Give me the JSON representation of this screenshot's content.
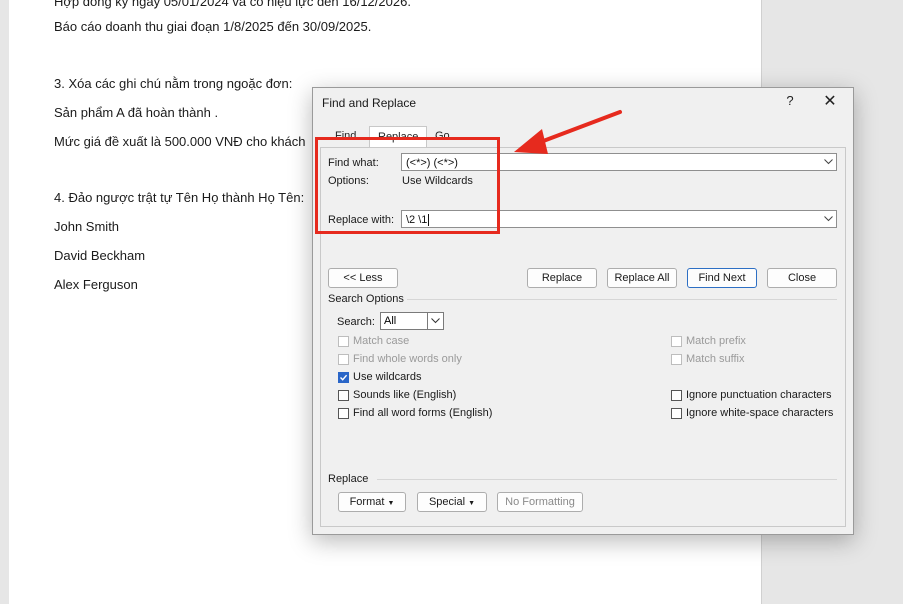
{
  "document": {
    "lines": [
      "Hợp đồng ký ngày  05/01/2024 và có hiệu lực đến  16/12/2026.",
      "Báo cáo doanh thu giai đoạn  1/8/2025 đến  30/09/2025.",
      "3. Xóa các ghi chú nằm trong ngoặc đơn:",
      "Sản phẩm A  đã hoàn thành .",
      "Mức giá đề xuất là 500.000 VNĐ  cho khách",
      "4. Đảo ngược trật tự Tên Họ thành Họ Tên:",
      "John Smith",
      "David Beckham",
      "Alex Ferguson"
    ]
  },
  "dialog": {
    "title": "Find and Replace",
    "help_icon": "?",
    "close_icon": "✕",
    "tabs": [
      {
        "label": "Find"
      },
      {
        "label": "Replace"
      },
      {
        "label": "Go To"
      }
    ],
    "find_what_label": "Find what:",
    "find_what_value": "(<*>) (<*>)",
    "options_label": "Options:",
    "options_value": "Use Wildcards",
    "replace_with_label": "Replace with:",
    "replace_with_value": "\\2 \\1",
    "buttons": {
      "less": "<< Less",
      "replace": "Replace",
      "replace_all": "Replace All",
      "find_next": "Find Next",
      "close": "Close"
    },
    "search_options_label": "Search Options",
    "search_label": "Search:",
    "search_value": "All",
    "checkboxes_left": [
      {
        "label": "Match case",
        "checked": false,
        "enabled": false
      },
      {
        "label": "Find whole words only",
        "checked": false,
        "enabled": false
      },
      {
        "label": "Use wildcards",
        "checked": true,
        "enabled": true
      },
      {
        "label": "Sounds like (English)",
        "checked": false,
        "enabled": true
      },
      {
        "label": "Find all word forms (English)",
        "checked": false,
        "enabled": true
      }
    ],
    "checkboxes_right": [
      {
        "label": "Match prefix",
        "checked": false,
        "enabled": false
      },
      {
        "label": "Match suffix",
        "checked": false,
        "enabled": false
      },
      {
        "label": "Ignore punctuation characters",
        "checked": false,
        "enabled": true
      },
      {
        "label": "Ignore white-space characters",
        "checked": false,
        "enabled": true
      }
    ],
    "replace_section_label": "Replace",
    "format_button": "Format",
    "special_button": "Special",
    "no_formatting_button": "No Formatting"
  },
  "colors": {
    "annotation_red": "#e62a1e",
    "accent_blue": "#2a66c8"
  }
}
